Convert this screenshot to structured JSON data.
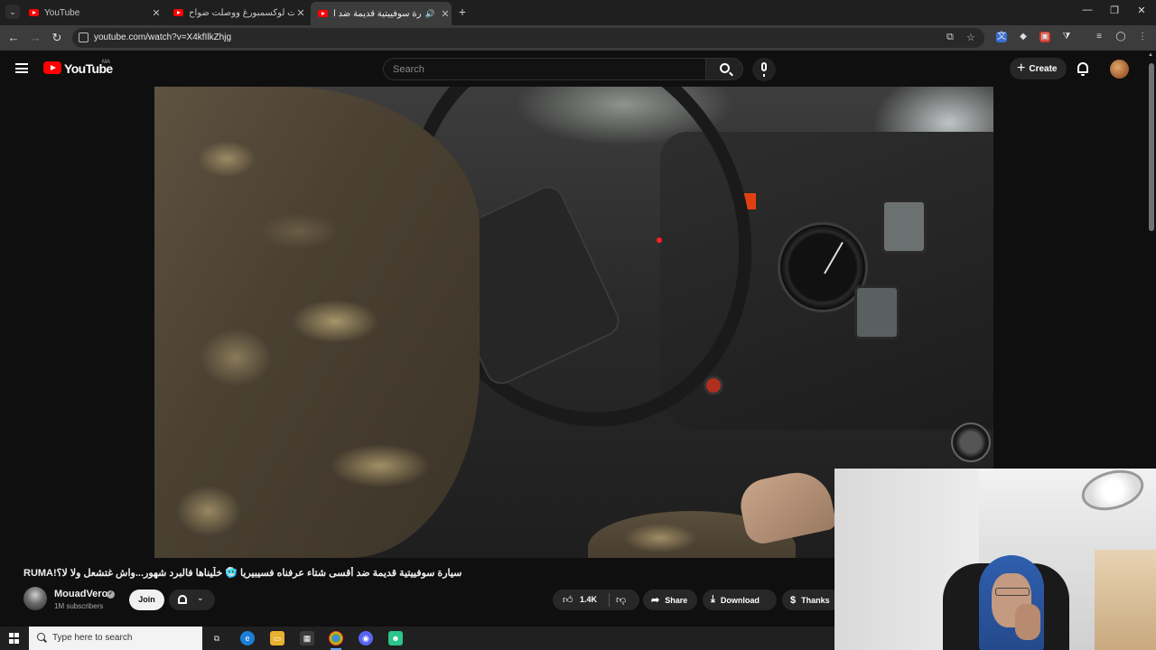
{
  "browser": {
    "tabs": [
      {
        "title": "YouTube",
        "active": false
      },
      {
        "title": "عبرت لوكسمبورغ ووصلت ضواح...",
        "active": false
      },
      {
        "title": "سيارة سوفييتية قديمة ضد أ...",
        "active": true
      }
    ],
    "url": "youtube.com/watch?v=X4kfIlkZhjg"
  },
  "youtube": {
    "logo_text": "YouTube",
    "country_code": "MA",
    "search_placeholder": "Search",
    "create_label": "Create"
  },
  "video": {
    "title": "سيارة سوفييتية قديمة ضد أقسى شتاء عرفناه فسيبيريا 🥶 خلّيناها فالبرد شهور...واش غتشعل ولا لا؟!RUMA",
    "channel": {
      "name": "MouadVero",
      "subscribers": "1M subscribers",
      "join_label": "Join"
    },
    "actions": {
      "likes": "1.4K",
      "share": "Share",
      "download": "Download",
      "thanks": "Thanks"
    }
  },
  "taskbar": {
    "search_placeholder": "Type here to search"
  },
  "colors": {
    "background": "#0f0f0f",
    "brand_red": "#ff0000",
    "button_dark": "#272727"
  }
}
